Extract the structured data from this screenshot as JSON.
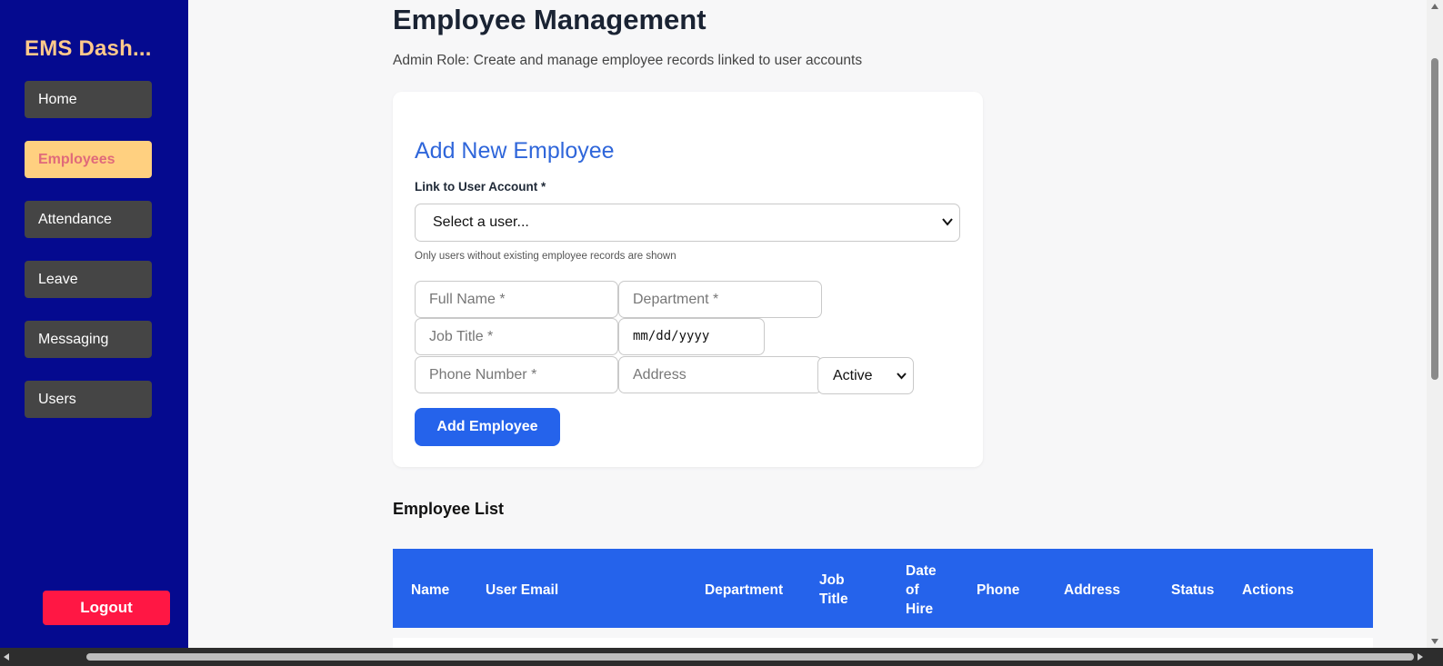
{
  "sidebar": {
    "brand": "EMS Dash...",
    "items": [
      {
        "label": "Home",
        "active": false
      },
      {
        "label": "Employees",
        "active": true
      },
      {
        "label": "Attendance",
        "active": false
      },
      {
        "label": "Leave",
        "active": false
      },
      {
        "label": "Messaging",
        "active": false
      },
      {
        "label": "Users",
        "active": false
      }
    ],
    "logout_label": "Logout"
  },
  "page": {
    "title": "Employee Management",
    "subtitle": "Admin Role: Create and manage employee records linked to user accounts"
  },
  "form": {
    "title": "Add New Employee",
    "link_label": "Link to User Account *",
    "user_select_value": "Select a user...",
    "hint": "Only users without existing employee records are shown",
    "full_name_placeholder": "Full Name *",
    "department_placeholder": "Department *",
    "job_title_placeholder": "Job Title *",
    "date_value": "mm/dd/yyyy",
    "phone_placeholder": "Phone Number *",
    "address_placeholder": "Address",
    "status_value": "Active",
    "submit_label": "Add Employee"
  },
  "employee_list": {
    "title": "Employee List",
    "columns": [
      "Name",
      "User Email",
      "Department",
      "Job\nTitle",
      "Date\nof\nHire",
      "Phone",
      "Address",
      "Status",
      "Actions"
    ]
  },
  "colors": {
    "sidebar_bg": "#050a8f",
    "brand": "#ffc98b",
    "active_nav_bg": "#ffd080",
    "active_nav_text": "#e06a7a",
    "accent": "#2563eb",
    "logout": "#ff1744"
  }
}
